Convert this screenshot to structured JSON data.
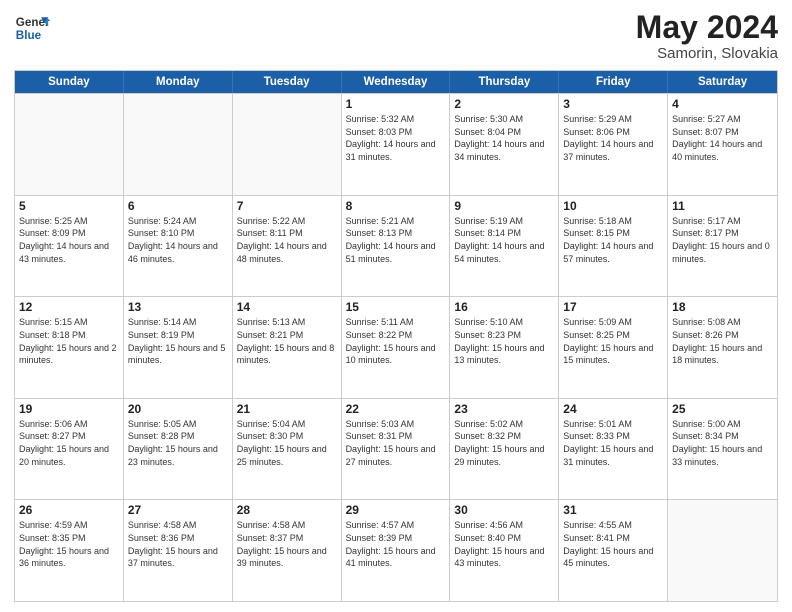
{
  "logo": {
    "line1": "General",
    "line2": "Blue"
  },
  "title": "May 2024",
  "subtitle": "Samorin, Slovakia",
  "header_days": [
    "Sunday",
    "Monday",
    "Tuesday",
    "Wednesday",
    "Thursday",
    "Friday",
    "Saturday"
  ],
  "weeks": [
    [
      {
        "day": "",
        "sunrise": "",
        "sunset": "",
        "daylight": "",
        "empty": true
      },
      {
        "day": "",
        "sunrise": "",
        "sunset": "",
        "daylight": "",
        "empty": true
      },
      {
        "day": "",
        "sunrise": "",
        "sunset": "",
        "daylight": "",
        "empty": true
      },
      {
        "day": "1",
        "sunrise": "Sunrise: 5:32 AM",
        "sunset": "Sunset: 8:03 PM",
        "daylight": "Daylight: 14 hours and 31 minutes.",
        "empty": false
      },
      {
        "day": "2",
        "sunrise": "Sunrise: 5:30 AM",
        "sunset": "Sunset: 8:04 PM",
        "daylight": "Daylight: 14 hours and 34 minutes.",
        "empty": false
      },
      {
        "day": "3",
        "sunrise": "Sunrise: 5:29 AM",
        "sunset": "Sunset: 8:06 PM",
        "daylight": "Daylight: 14 hours and 37 minutes.",
        "empty": false
      },
      {
        "day": "4",
        "sunrise": "Sunrise: 5:27 AM",
        "sunset": "Sunset: 8:07 PM",
        "daylight": "Daylight: 14 hours and 40 minutes.",
        "empty": false
      }
    ],
    [
      {
        "day": "5",
        "sunrise": "Sunrise: 5:25 AM",
        "sunset": "Sunset: 8:09 PM",
        "daylight": "Daylight: 14 hours and 43 minutes.",
        "empty": false
      },
      {
        "day": "6",
        "sunrise": "Sunrise: 5:24 AM",
        "sunset": "Sunset: 8:10 PM",
        "daylight": "Daylight: 14 hours and 46 minutes.",
        "empty": false
      },
      {
        "day": "7",
        "sunrise": "Sunrise: 5:22 AM",
        "sunset": "Sunset: 8:11 PM",
        "daylight": "Daylight: 14 hours and 48 minutes.",
        "empty": false
      },
      {
        "day": "8",
        "sunrise": "Sunrise: 5:21 AM",
        "sunset": "Sunset: 8:13 PM",
        "daylight": "Daylight: 14 hours and 51 minutes.",
        "empty": false
      },
      {
        "day": "9",
        "sunrise": "Sunrise: 5:19 AM",
        "sunset": "Sunset: 8:14 PM",
        "daylight": "Daylight: 14 hours and 54 minutes.",
        "empty": false
      },
      {
        "day": "10",
        "sunrise": "Sunrise: 5:18 AM",
        "sunset": "Sunset: 8:15 PM",
        "daylight": "Daylight: 14 hours and 57 minutes.",
        "empty": false
      },
      {
        "day": "11",
        "sunrise": "Sunrise: 5:17 AM",
        "sunset": "Sunset: 8:17 PM",
        "daylight": "Daylight: 15 hours and 0 minutes.",
        "empty": false
      }
    ],
    [
      {
        "day": "12",
        "sunrise": "Sunrise: 5:15 AM",
        "sunset": "Sunset: 8:18 PM",
        "daylight": "Daylight: 15 hours and 2 minutes.",
        "empty": false
      },
      {
        "day": "13",
        "sunrise": "Sunrise: 5:14 AM",
        "sunset": "Sunset: 8:19 PM",
        "daylight": "Daylight: 15 hours and 5 minutes.",
        "empty": false
      },
      {
        "day": "14",
        "sunrise": "Sunrise: 5:13 AM",
        "sunset": "Sunset: 8:21 PM",
        "daylight": "Daylight: 15 hours and 8 minutes.",
        "empty": false
      },
      {
        "day": "15",
        "sunrise": "Sunrise: 5:11 AM",
        "sunset": "Sunset: 8:22 PM",
        "daylight": "Daylight: 15 hours and 10 minutes.",
        "empty": false
      },
      {
        "day": "16",
        "sunrise": "Sunrise: 5:10 AM",
        "sunset": "Sunset: 8:23 PM",
        "daylight": "Daylight: 15 hours and 13 minutes.",
        "empty": false
      },
      {
        "day": "17",
        "sunrise": "Sunrise: 5:09 AM",
        "sunset": "Sunset: 8:25 PM",
        "daylight": "Daylight: 15 hours and 15 minutes.",
        "empty": false
      },
      {
        "day": "18",
        "sunrise": "Sunrise: 5:08 AM",
        "sunset": "Sunset: 8:26 PM",
        "daylight": "Daylight: 15 hours and 18 minutes.",
        "empty": false
      }
    ],
    [
      {
        "day": "19",
        "sunrise": "Sunrise: 5:06 AM",
        "sunset": "Sunset: 8:27 PM",
        "daylight": "Daylight: 15 hours and 20 minutes.",
        "empty": false
      },
      {
        "day": "20",
        "sunrise": "Sunrise: 5:05 AM",
        "sunset": "Sunset: 8:28 PM",
        "daylight": "Daylight: 15 hours and 23 minutes.",
        "empty": false
      },
      {
        "day": "21",
        "sunrise": "Sunrise: 5:04 AM",
        "sunset": "Sunset: 8:30 PM",
        "daylight": "Daylight: 15 hours and 25 minutes.",
        "empty": false
      },
      {
        "day": "22",
        "sunrise": "Sunrise: 5:03 AM",
        "sunset": "Sunset: 8:31 PM",
        "daylight": "Daylight: 15 hours and 27 minutes.",
        "empty": false
      },
      {
        "day": "23",
        "sunrise": "Sunrise: 5:02 AM",
        "sunset": "Sunset: 8:32 PM",
        "daylight": "Daylight: 15 hours and 29 minutes.",
        "empty": false
      },
      {
        "day": "24",
        "sunrise": "Sunrise: 5:01 AM",
        "sunset": "Sunset: 8:33 PM",
        "daylight": "Daylight: 15 hours and 31 minutes.",
        "empty": false
      },
      {
        "day": "25",
        "sunrise": "Sunrise: 5:00 AM",
        "sunset": "Sunset: 8:34 PM",
        "daylight": "Daylight: 15 hours and 33 minutes.",
        "empty": false
      }
    ],
    [
      {
        "day": "26",
        "sunrise": "Sunrise: 4:59 AM",
        "sunset": "Sunset: 8:35 PM",
        "daylight": "Daylight: 15 hours and 36 minutes.",
        "empty": false
      },
      {
        "day": "27",
        "sunrise": "Sunrise: 4:58 AM",
        "sunset": "Sunset: 8:36 PM",
        "daylight": "Daylight: 15 hours and 37 minutes.",
        "empty": false
      },
      {
        "day": "28",
        "sunrise": "Sunrise: 4:58 AM",
        "sunset": "Sunset: 8:37 PM",
        "daylight": "Daylight: 15 hours and 39 minutes.",
        "empty": false
      },
      {
        "day": "29",
        "sunrise": "Sunrise: 4:57 AM",
        "sunset": "Sunset: 8:39 PM",
        "daylight": "Daylight: 15 hours and 41 minutes.",
        "empty": false
      },
      {
        "day": "30",
        "sunrise": "Sunrise: 4:56 AM",
        "sunset": "Sunset: 8:40 PM",
        "daylight": "Daylight: 15 hours and 43 minutes.",
        "empty": false
      },
      {
        "day": "31",
        "sunrise": "Sunrise: 4:55 AM",
        "sunset": "Sunset: 8:41 PM",
        "daylight": "Daylight: 15 hours and 45 minutes.",
        "empty": false
      },
      {
        "day": "",
        "sunrise": "",
        "sunset": "",
        "daylight": "",
        "empty": true
      }
    ]
  ]
}
